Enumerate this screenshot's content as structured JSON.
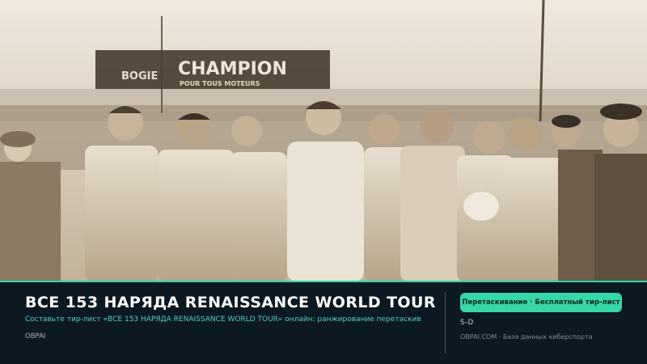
{
  "hero": {
    "banner_text": "CHAMPION",
    "banner_left_text": "BOGIE",
    "banner_sub_text": "POUR TOUS MOTEURS"
  },
  "info": {
    "title": "ВСЕ 153 НАРЯДА RENAISSANCE WORLD TOUR",
    "subtitle": "Составьте тир-лист «ВСЕ 153 НАРЯДА RENAISSANCE WORLD TOUR» онлайн: ранжирование перетаскив",
    "brand": "OBPAI"
  },
  "side": {
    "cta_label": "Перетаскивание · Бесплатный тир-лист",
    "shortcode": "S–D",
    "footer_note": "OBPAI.COM · База данных киберспорта"
  },
  "colors": {
    "accent": "#2fd6a6",
    "background": "#0c1822",
    "subtitle": "#4fd1c8"
  }
}
